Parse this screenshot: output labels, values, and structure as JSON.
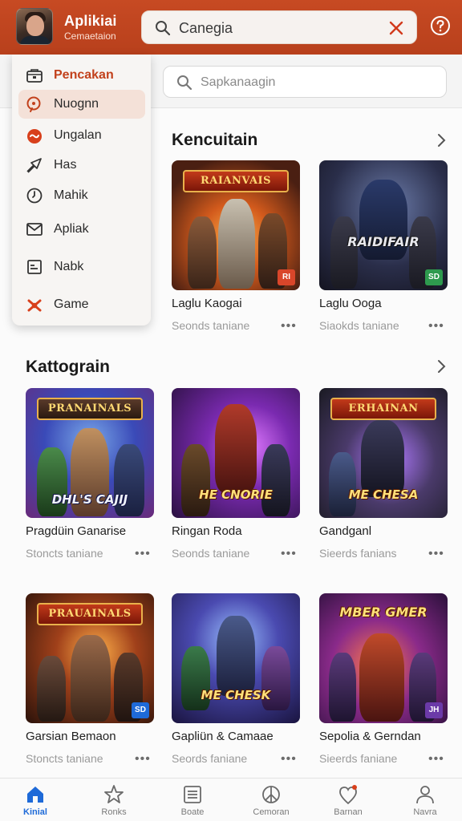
{
  "header": {
    "app_title": "Aplikiai",
    "app_subtitle": "Cemaetaion",
    "search_value": "Canegia"
  },
  "menu": {
    "items": [
      {
        "label": "Pencakan",
        "icon": "store-icon"
      },
      {
        "label": "Nuognn",
        "icon": "search-icon"
      },
      {
        "label": "Ungalan",
        "icon": "flame-icon"
      },
      {
        "label": "Has",
        "icon": "arrow-icon"
      },
      {
        "label": "Mahik",
        "icon": "clock-icon"
      },
      {
        "label": "Apliak",
        "icon": "mail-icon"
      },
      {
        "label": "Nabk",
        "icon": "document-icon"
      },
      {
        "label": "Game",
        "icon": "gamepad-icon"
      }
    ]
  },
  "secondary_search": {
    "placeholder": "Sapkanaagin"
  },
  "sections": [
    {
      "title": "Kencuitain",
      "cards": [
        {
          "title": "Laglu Kaogai",
          "subtitle": "Seonds taniane",
          "banner": "RAIANVAIS",
          "logo": "",
          "badge": "RI",
          "badge_color": "#d9462a",
          "theme": "fire"
        },
        {
          "title": "Laglu Ooga",
          "subtitle": "Siaokds taniane",
          "banner": "",
          "logo": "RAIDIFAIR",
          "badge": "SD",
          "badge_color": "#2e9a4e",
          "theme": "dusk"
        }
      ]
    },
    {
      "title": "Kattograin",
      "cards": [
        {
          "title": "Pragdüin Ganarise",
          "subtitle": "Stoncts taniane",
          "banner": "PRANAINALS",
          "logo": "DHL'S CAJIJ",
          "badge": "",
          "badge_color": "",
          "theme": "blue"
        },
        {
          "title": "Ringan Roda",
          "subtitle": "Seonds taniane",
          "banner": "",
          "logo": "HE CNORIE",
          "badge": "",
          "badge_color": "",
          "theme": "purple"
        },
        {
          "title": "Gandganl",
          "subtitle": "Sieerds fanians",
          "banner": "ERHAINAN",
          "logo": "ME CHESA",
          "badge": "",
          "badge_color": "",
          "theme": "magic"
        }
      ]
    },
    {
      "title": "",
      "cards": [
        {
          "title": "Garsian Bemaon",
          "subtitle": "Stoncts taniane",
          "banner": "PRAUAINALS",
          "logo": "",
          "badge": "SD",
          "badge_color": "#1e6ad8",
          "theme": "ember"
        },
        {
          "title": "Gapliün & Camaae",
          "subtitle": "Seords faniane",
          "banner": "",
          "logo": "ME CHESK",
          "badge": "",
          "badge_color": "",
          "theme": "storm"
        },
        {
          "title": "Sepolia & Gerndan",
          "subtitle": "Sieerds faniane",
          "banner": "",
          "logo": "MBER GMER",
          "badge": "JH",
          "badge_color": "#6b3aa8",
          "theme": "violet"
        }
      ]
    }
  ],
  "bottom_nav": [
    {
      "label": "Kinial",
      "icon": "home-icon",
      "active": true
    },
    {
      "label": "Ronks",
      "icon": "star-icon",
      "active": false
    },
    {
      "label": "Boate",
      "icon": "list-icon",
      "active": false
    },
    {
      "label": "Cemoran",
      "icon": "peace-icon",
      "active": false
    },
    {
      "label": "Barnan",
      "icon": "heart-pin-icon",
      "active": false
    },
    {
      "label": "Navra",
      "icon": "user-icon",
      "active": false
    }
  ],
  "colors": {
    "header": "#c74a23",
    "accent": "#c2411c",
    "nav_active": "#1e6ad8"
  }
}
